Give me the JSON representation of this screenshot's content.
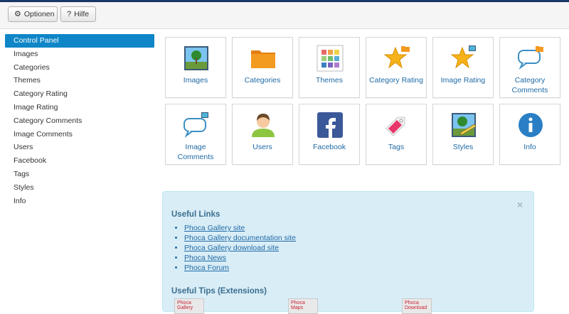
{
  "toolbar": {
    "options_label": "Optionen",
    "help_label": "Hilfe",
    "options_icon": "gear-icon",
    "help_icon": "question-icon"
  },
  "sidebar": {
    "active_color": "#0e86c7",
    "items": [
      {
        "label": "Control Panel",
        "active": true
      },
      {
        "label": "Images"
      },
      {
        "label": "Categories"
      },
      {
        "label": "Themes"
      },
      {
        "label": "Category Rating"
      },
      {
        "label": "Image Rating"
      },
      {
        "label": "Category Comments"
      },
      {
        "label": "Image Comments"
      },
      {
        "label": "Users"
      },
      {
        "label": "Facebook"
      },
      {
        "label": "Tags"
      },
      {
        "label": "Styles"
      },
      {
        "label": "Info"
      }
    ]
  },
  "tiles": [
    {
      "label": "Images",
      "icon": "image-icon"
    },
    {
      "label": "Categories",
      "icon": "folder-icon"
    },
    {
      "label": "Themes",
      "icon": "themes-icon"
    },
    {
      "label": "Category Rating",
      "icon": "star-folder-icon"
    },
    {
      "label": "Image Rating",
      "icon": "star-image-icon"
    },
    {
      "label": "Category Comments",
      "icon": "comment-folder-icon"
    },
    {
      "label": "Image Comments",
      "icon": "comment-image-icon"
    },
    {
      "label": "Users",
      "icon": "user-icon"
    },
    {
      "label": "Facebook",
      "icon": "facebook-icon"
    },
    {
      "label": "Tags",
      "icon": "tag-icon"
    },
    {
      "label": "Styles",
      "icon": "styles-icon"
    },
    {
      "label": "Info",
      "icon": "info-icon"
    }
  ],
  "info_panel": {
    "close_label": "×",
    "useful_links_title": "Useful Links",
    "links": [
      "Phoca Gallery site",
      "Phoca Gallery documentation site",
      "Phoca Gallery download site",
      "Phoca News",
      "Phoca Forum"
    ],
    "useful_tips_title": "Useful Tips (Extensions)",
    "books": [
      "Phoca Gallery",
      "Phoca Maps",
      "Phoca Download"
    ]
  }
}
